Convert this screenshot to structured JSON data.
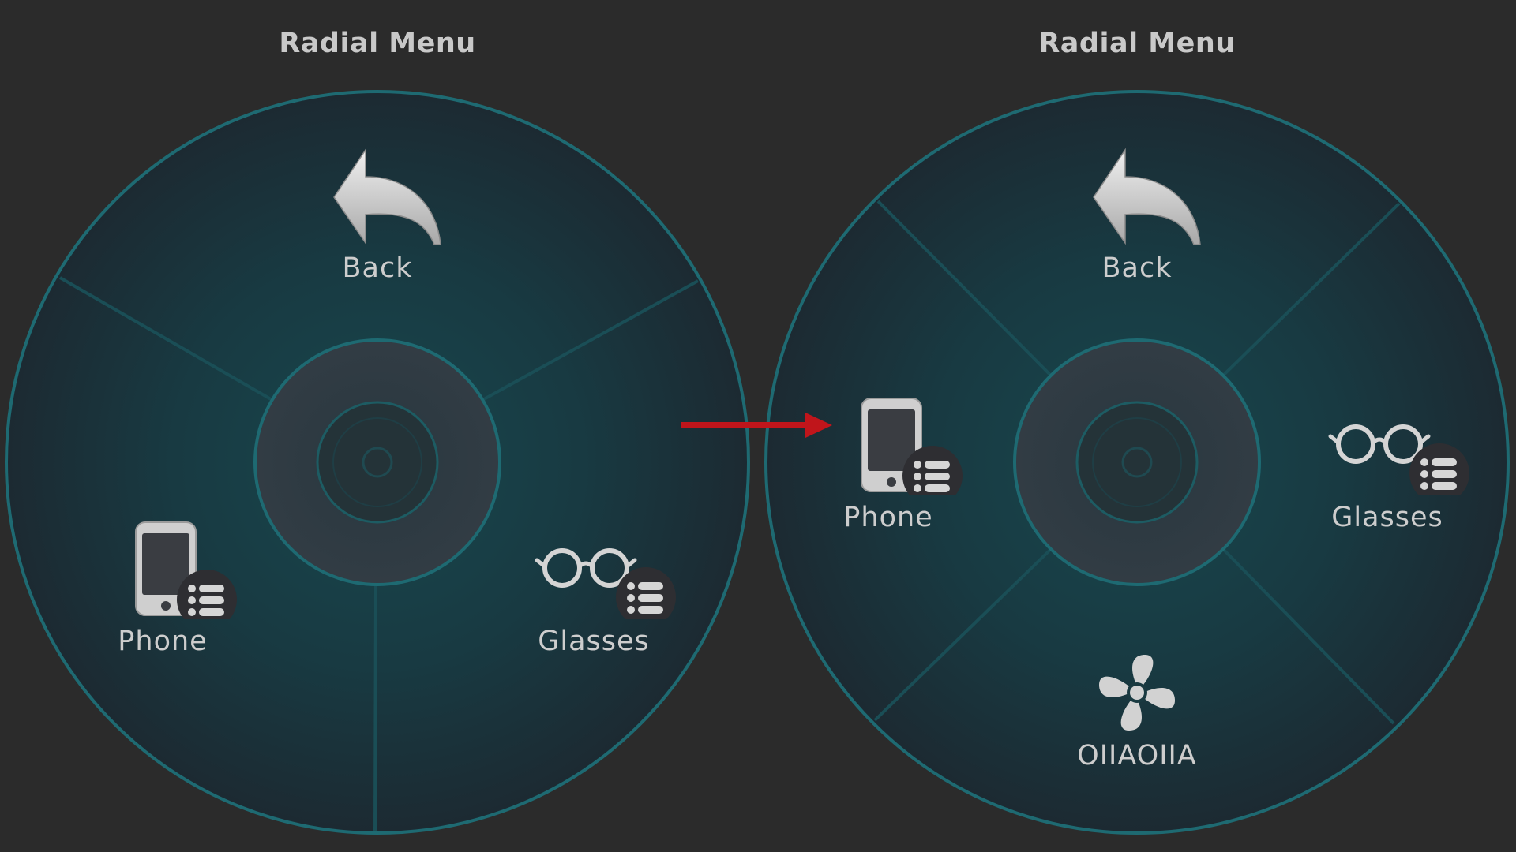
{
  "colors": {
    "background": "#2b2b2b",
    "ring": "#1d6870",
    "wheel_center": "#18434a",
    "wheel_edge": "#1c2b33",
    "hub": "#2f3a42",
    "icon": "#d0d0d0",
    "arrow": "#c0151b"
  },
  "left_menu": {
    "title": "Radial Menu",
    "items": [
      {
        "label": "Back",
        "icon": "back-arrow-icon"
      },
      {
        "label": "Phone",
        "icon": "phone-icon",
        "badge": "list-icon"
      },
      {
        "label": "Glasses",
        "icon": "glasses-icon",
        "badge": "list-icon"
      }
    ]
  },
  "right_menu": {
    "title": "Radial Menu",
    "items": [
      {
        "label": "Back",
        "icon": "back-arrow-icon"
      },
      {
        "label": "Phone",
        "icon": "phone-icon",
        "badge": "list-icon"
      },
      {
        "label": "Glasses",
        "icon": "glasses-icon",
        "badge": "list-icon"
      },
      {
        "label": "OIIAOIIA",
        "icon": "fan-icon"
      }
    ]
  },
  "transition": {
    "icon": "right-arrow-icon"
  }
}
